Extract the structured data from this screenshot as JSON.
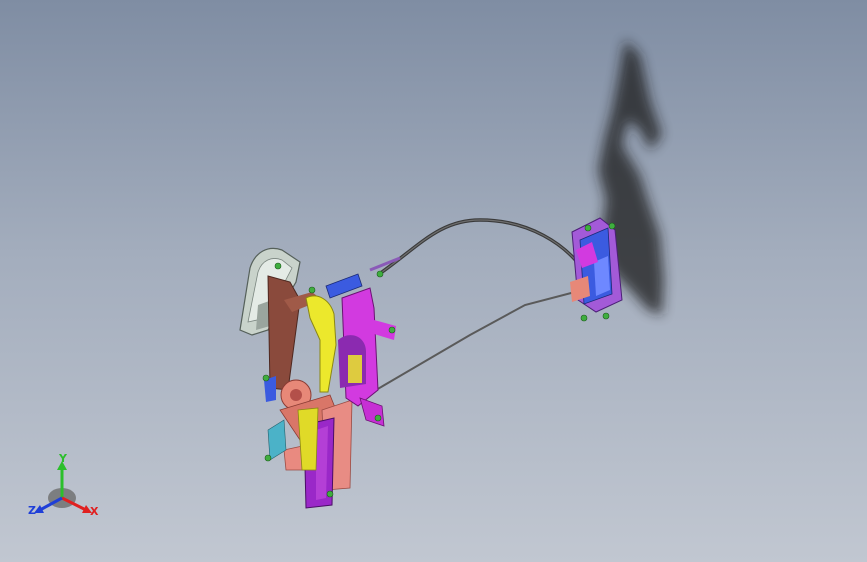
{
  "viewport": {
    "background_top": "#7f8da3",
    "background_bottom": "#c1c7d1"
  },
  "model": {
    "part_colors": {
      "motor_housing": "#c9d3cb",
      "lever_brown": "#8a4a3c",
      "plate_magenta": "#d23ae0",
      "arm_yellow": "#ece82c",
      "gear_salmon": "#e78878",
      "latch_blue": "#3b5be0",
      "cable": "#3a3a3a",
      "pin": "#3fae3f",
      "shadow": "#1a1a1a"
    }
  },
  "triad": {
    "y_label": "Y",
    "z_label": "Z",
    "x_label": "X",
    "y_color": "#2bbf2b",
    "z_color": "#1f3fd8",
    "x_color": "#e02020"
  }
}
